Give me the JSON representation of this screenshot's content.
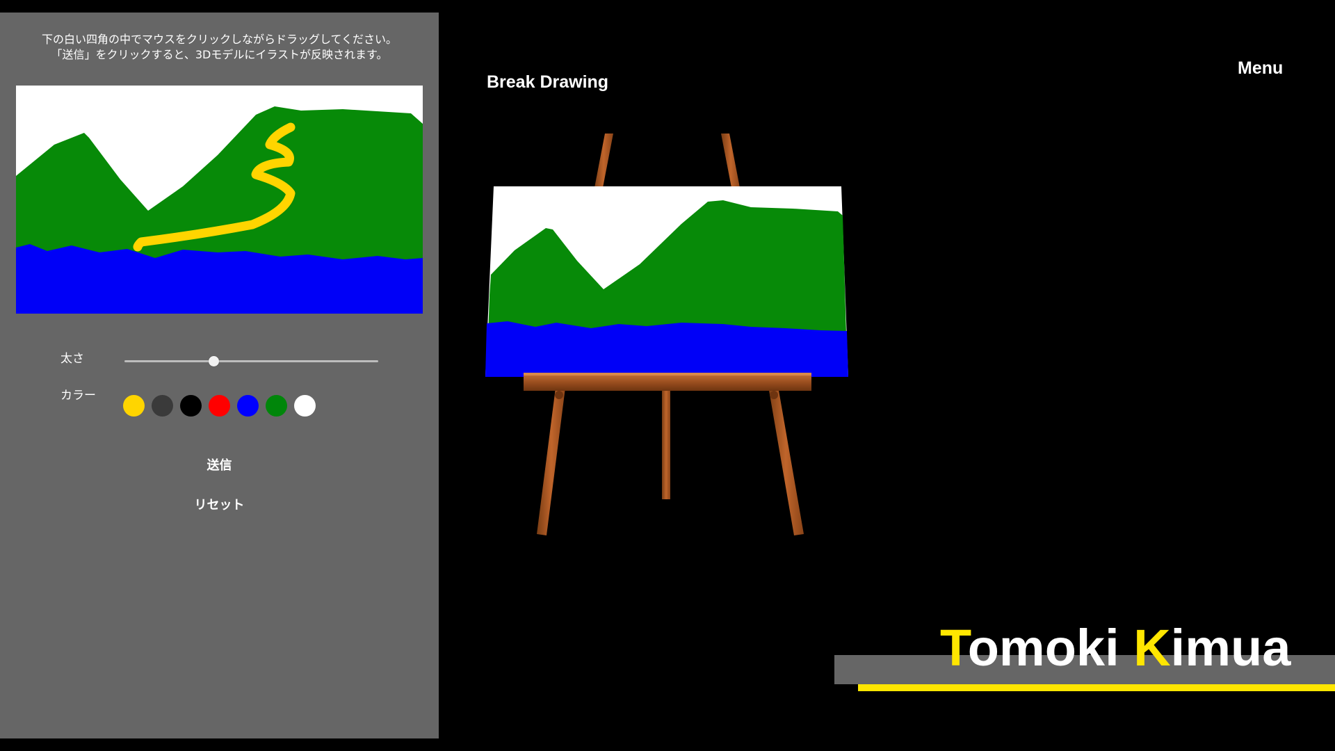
{
  "header": {
    "title": "Break Drawing",
    "menu_label": "Menu"
  },
  "panel": {
    "instructions": [
      "下の白い四角の中でマウスをクリックしながらドラッグしてください。",
      "「送信」をクリックすると、3Dモデルにイラストが反映されます。"
    ],
    "size_label": "太さ",
    "size_value": 0.35,
    "color_label": "カラー",
    "colors": [
      {
        "name": "yellow",
        "hex": "#ffd500"
      },
      {
        "name": "dark-gray",
        "hex": "#3a3a3a"
      },
      {
        "name": "black",
        "hex": "#000000"
      },
      {
        "name": "red",
        "hex": "#ff0000"
      },
      {
        "name": "blue",
        "hex": "#0000ff"
      },
      {
        "name": "green",
        "hex": "#00860a"
      },
      {
        "name": "white",
        "hex": "#ffffff"
      }
    ],
    "send_label": "送信",
    "reset_label": "リセット"
  },
  "drawing_colors": {
    "sky": "#ffffff",
    "mountain": "#078a08",
    "water": "#0000f7",
    "path": "#ffd500"
  },
  "signature": {
    "first_initial": "T",
    "first_rest": "omoki",
    "last_initial": "K",
    "last_rest": "imua"
  }
}
